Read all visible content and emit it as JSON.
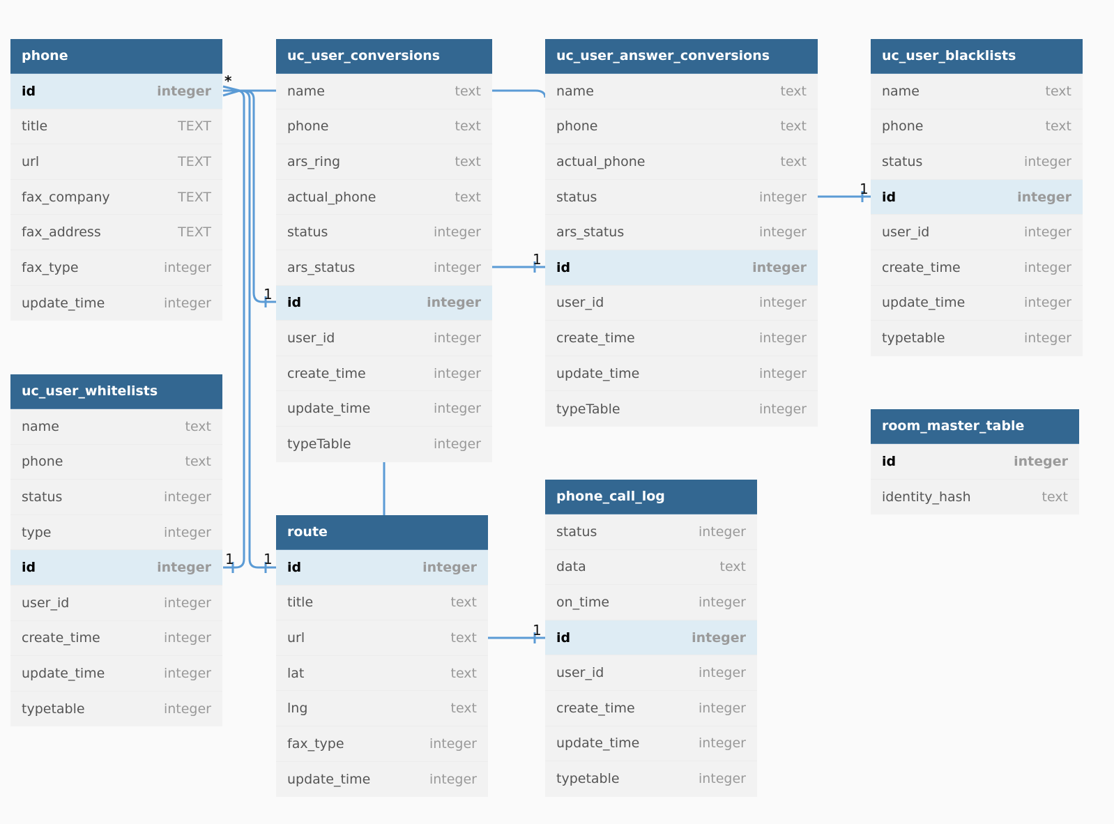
{
  "colors": {
    "header": "#336791",
    "pk_row": "#deecf4",
    "row": "#f2f2f2",
    "link": "#5b9bd5",
    "background": "#fafafa"
  },
  "tables": {
    "phone": {
      "title": "phone",
      "fields": [
        {
          "name": "id",
          "type": "integer",
          "pk": true
        },
        {
          "name": "title",
          "type": "TEXT"
        },
        {
          "name": "url",
          "type": "TEXT"
        },
        {
          "name": "fax_company",
          "type": "TEXT"
        },
        {
          "name": "fax_address",
          "type": "TEXT"
        },
        {
          "name": "fax_type",
          "type": "integer"
        },
        {
          "name": "update_time",
          "type": "integer"
        }
      ]
    },
    "uc_user_conversions": {
      "title": "uc_user_conversions",
      "fields": [
        {
          "name": "name",
          "type": "text"
        },
        {
          "name": "phone",
          "type": "text"
        },
        {
          "name": "ars_ring",
          "type": "text"
        },
        {
          "name": "actual_phone",
          "type": "text"
        },
        {
          "name": "status",
          "type": "integer"
        },
        {
          "name": "ars_status",
          "type": "integer"
        },
        {
          "name": "id",
          "type": "integer",
          "pk": true
        },
        {
          "name": "user_id",
          "type": "integer"
        },
        {
          "name": "create_time",
          "type": "integer"
        },
        {
          "name": "update_time",
          "type": "integer"
        },
        {
          "name": "typeTable",
          "type": "integer"
        }
      ]
    },
    "uc_user_answer_conversions": {
      "title": "uc_user_answer_conversions",
      "fields": [
        {
          "name": "name",
          "type": "text"
        },
        {
          "name": "phone",
          "type": "text"
        },
        {
          "name": "actual_phone",
          "type": "text"
        },
        {
          "name": "status",
          "type": "integer"
        },
        {
          "name": "ars_status",
          "type": "integer"
        },
        {
          "name": "id",
          "type": "integer",
          "pk": true
        },
        {
          "name": "user_id",
          "type": "integer"
        },
        {
          "name": "create_time",
          "type": "integer"
        },
        {
          "name": "update_time",
          "type": "integer"
        },
        {
          "name": "typeTable",
          "type": "integer"
        }
      ]
    },
    "uc_user_blacklists": {
      "title": "uc_user_blacklists",
      "fields": [
        {
          "name": "name",
          "type": "text"
        },
        {
          "name": "phone",
          "type": "text"
        },
        {
          "name": "status",
          "type": "integer"
        },
        {
          "name": "id",
          "type": "integer",
          "pk": true
        },
        {
          "name": "user_id",
          "type": "integer"
        },
        {
          "name": "create_time",
          "type": "integer"
        },
        {
          "name": "update_time",
          "type": "integer"
        },
        {
          "name": "typetable",
          "type": "integer"
        }
      ]
    },
    "uc_user_whitelists": {
      "title": "uc_user_whitelists",
      "fields": [
        {
          "name": "name",
          "type": "text"
        },
        {
          "name": "phone",
          "type": "text"
        },
        {
          "name": "status",
          "type": "integer"
        },
        {
          "name": "type",
          "type": "integer"
        },
        {
          "name": "id",
          "type": "integer",
          "pk": true
        },
        {
          "name": "user_id",
          "type": "integer"
        },
        {
          "name": "create_time",
          "type": "integer"
        },
        {
          "name": "update_time",
          "type": "integer"
        },
        {
          "name": "typetable",
          "type": "integer"
        }
      ]
    },
    "route": {
      "title": "route",
      "fields": [
        {
          "name": "id",
          "type": "integer",
          "pk": true
        },
        {
          "name": "title",
          "type": "text"
        },
        {
          "name": "url",
          "type": "text"
        },
        {
          "name": "lat",
          "type": "text"
        },
        {
          "name": "lng",
          "type": "text"
        },
        {
          "name": "fax_type",
          "type": "integer"
        },
        {
          "name": "update_time",
          "type": "integer"
        }
      ]
    },
    "phone_call_log": {
      "title": "phone_call_log",
      "fields": [
        {
          "name": "status",
          "type": "integer"
        },
        {
          "name": "data",
          "type": "text"
        },
        {
          "name": "on_time",
          "type": "integer"
        },
        {
          "name": "id",
          "type": "integer",
          "pk": true
        },
        {
          "name": "user_id",
          "type": "integer"
        },
        {
          "name": "create_time",
          "type": "integer"
        },
        {
          "name": "update_time",
          "type": "integer"
        },
        {
          "name": "typetable",
          "type": "integer"
        }
      ]
    },
    "room_master_table": {
      "title": "room_master_table",
      "fields": [
        {
          "name": "id",
          "type": "integer",
          "bold": true
        },
        {
          "name": "identity_hash",
          "type": "text"
        }
      ]
    }
  },
  "relationships": [
    {
      "from": "phone.id",
      "to": "uc_user_conversions.name",
      "from_card": "*",
      "to_card": ""
    },
    {
      "from": "phone.id",
      "to": "uc_user_conversions.id",
      "from_card": "*",
      "to_card": "1"
    },
    {
      "from": "phone.id",
      "to": "uc_user_whitelists.id",
      "from_card": "*",
      "to_card": "1"
    },
    {
      "from": "phone.id",
      "to": "route.id",
      "from_card": "*",
      "to_card": "1"
    },
    {
      "from": "uc_user_conversions.name",
      "to": "uc_user_answer_conversions.name",
      "from_card": "",
      "to_card": ""
    },
    {
      "from": "uc_user_conversions.ars_status",
      "to": "uc_user_answer_conversions.id",
      "from_card": "",
      "to_card": "1"
    },
    {
      "from": "uc_user_answer_conversions.status",
      "to": "uc_user_blacklists.id",
      "from_card": "",
      "to_card": "1"
    },
    {
      "from": "uc_user_conversions",
      "to": "route",
      "from_card": "",
      "to_card": ""
    },
    {
      "from": "route.url",
      "to": "phone_call_log.id",
      "from_card": "",
      "to_card": "1"
    }
  ],
  "labels": {
    "many": "*",
    "one": "1"
  }
}
